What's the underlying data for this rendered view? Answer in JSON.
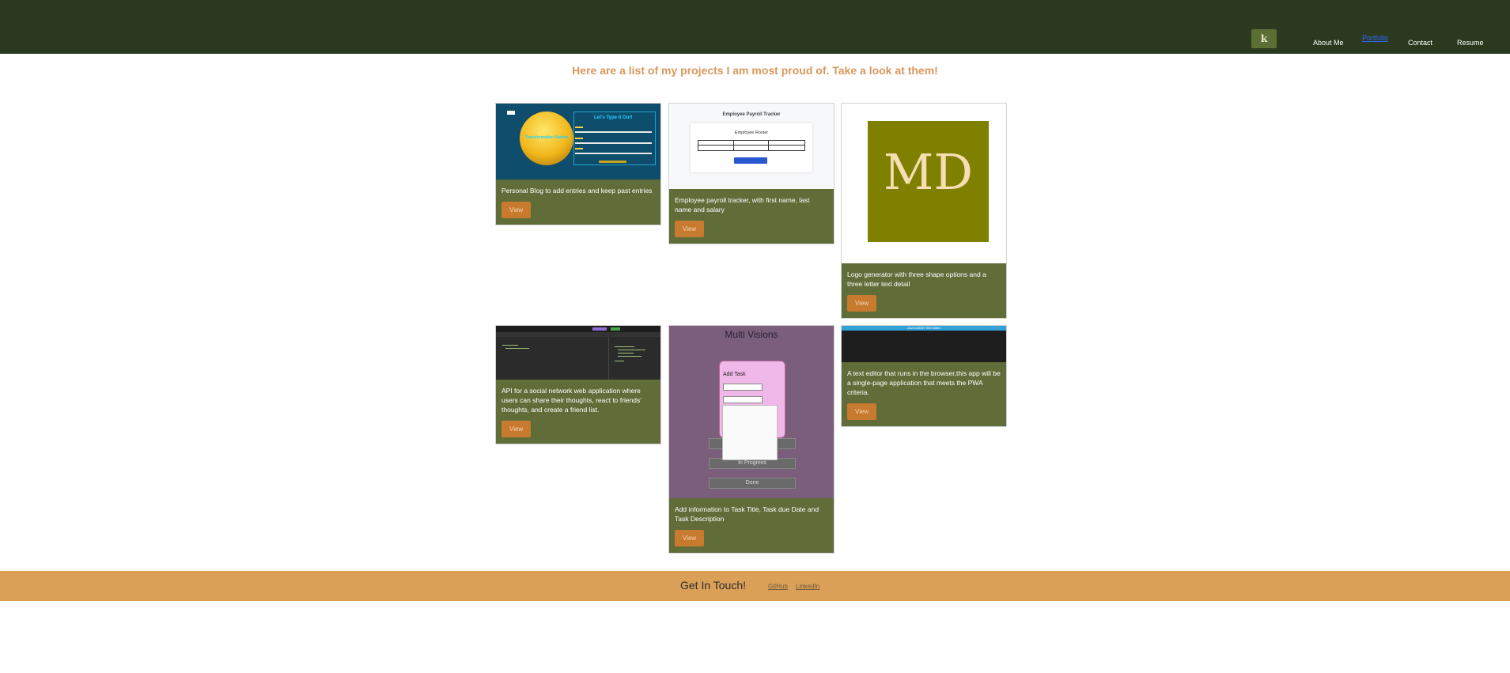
{
  "nav": {
    "logo_text": "k",
    "links": [
      "About Me",
      "Portfolio",
      "Contact",
      "Resume"
    ]
  },
  "intro": "Here are a list of my projects I am most proud of. Take a look at them!",
  "projects": [
    {
      "thumb_title": "Let's Type it Out!",
      "thumb_orb_text": "Transformation Station",
      "description": "Personal Blog to add entries and keep past entries",
      "button": "View"
    },
    {
      "thumb_title": "Employee Payroll Tracker",
      "thumb_panel_title": "Employee Roster",
      "description": "Employee payroll tracker, with first name, last name and salary",
      "button": "View"
    },
    {
      "thumb_logo": "MD",
      "description": "Logo generator with three shape options and a three letter text detail",
      "button": "View"
    },
    {
      "description": "API for a social network web application where users can share their thoughts, react to friends' thoughts, and create a friend list.",
      "button": "View"
    },
    {
      "thumb_title": "Multi Visions",
      "thumb_modal_title": "Add Task",
      "thumb_slots": [
        "In Progress",
        "Done"
      ],
      "description": "Add information to Task Title, Task due Date and Task Description",
      "button": "View"
    },
    {
      "thumb_title": "Just Another Text Editor",
      "description": "A text editor that runs in the browser,this app will be a single-page application that meets the PWA criteria.",
      "button": "View"
    }
  ],
  "footer": {
    "title": "Get In Touch!",
    "links": [
      "GitHub",
      "LinkedIn"
    ]
  },
  "colors": {
    "navbar": "#2b3a1e",
    "accent": "#d9975b",
    "card_body": "#606d39",
    "button": "#c87a2e",
    "footer": "#dba058"
  }
}
